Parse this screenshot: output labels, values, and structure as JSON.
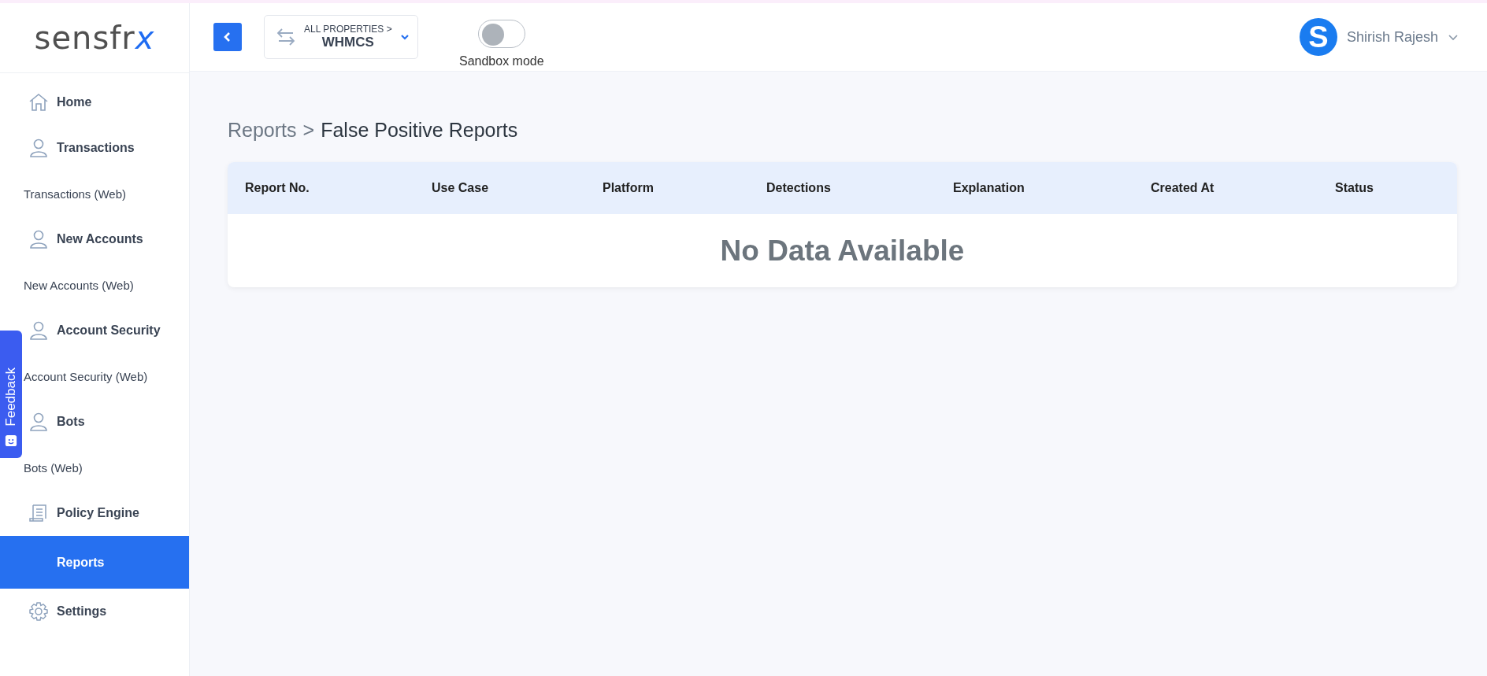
{
  "logo": "sensfrx",
  "sidebar": {
    "items": [
      {
        "label": "Home",
        "kind": "home",
        "selected": false
      },
      {
        "label": "Transactions",
        "kind": "user",
        "selected": false
      },
      {
        "label": "Transactions (Web)",
        "kind": "sub",
        "selected": false
      },
      {
        "label": "New Accounts",
        "kind": "user",
        "selected": false
      },
      {
        "label": "New Accounts (Web)",
        "kind": "sub",
        "selected": false
      },
      {
        "label": "Account Security",
        "kind": "user",
        "selected": false
      },
      {
        "label": "Account Security (Web)",
        "kind": "sub",
        "selected": false
      },
      {
        "label": "Bots",
        "kind": "user",
        "selected": false
      },
      {
        "label": "Bots (Web)",
        "kind": "sub",
        "selected": false
      },
      {
        "label": "Policy Engine",
        "kind": "policy",
        "selected": false
      },
      {
        "label": "Reports",
        "kind": "plain",
        "selected": true
      },
      {
        "label": "Settings",
        "kind": "settings",
        "selected": false
      }
    ]
  },
  "topbar": {
    "property_label": "ALL PROPERTIES >",
    "property": "WHMCS",
    "sandbox": {
      "label": "Sandbox mode",
      "on": false
    },
    "user": {
      "initial": "S",
      "name": "Shirish Rajesh"
    }
  },
  "breadcrumb": {
    "parent": "Reports",
    "separator": ">",
    "current": "False Positive Reports"
  },
  "table": {
    "columns": [
      "Report No.",
      "Use Case",
      "Platform",
      "Detections",
      "Explanation",
      "Created At",
      "Status"
    ],
    "empty_message": "No Data Available"
  },
  "feedback": {
    "label": "Feedback"
  }
}
